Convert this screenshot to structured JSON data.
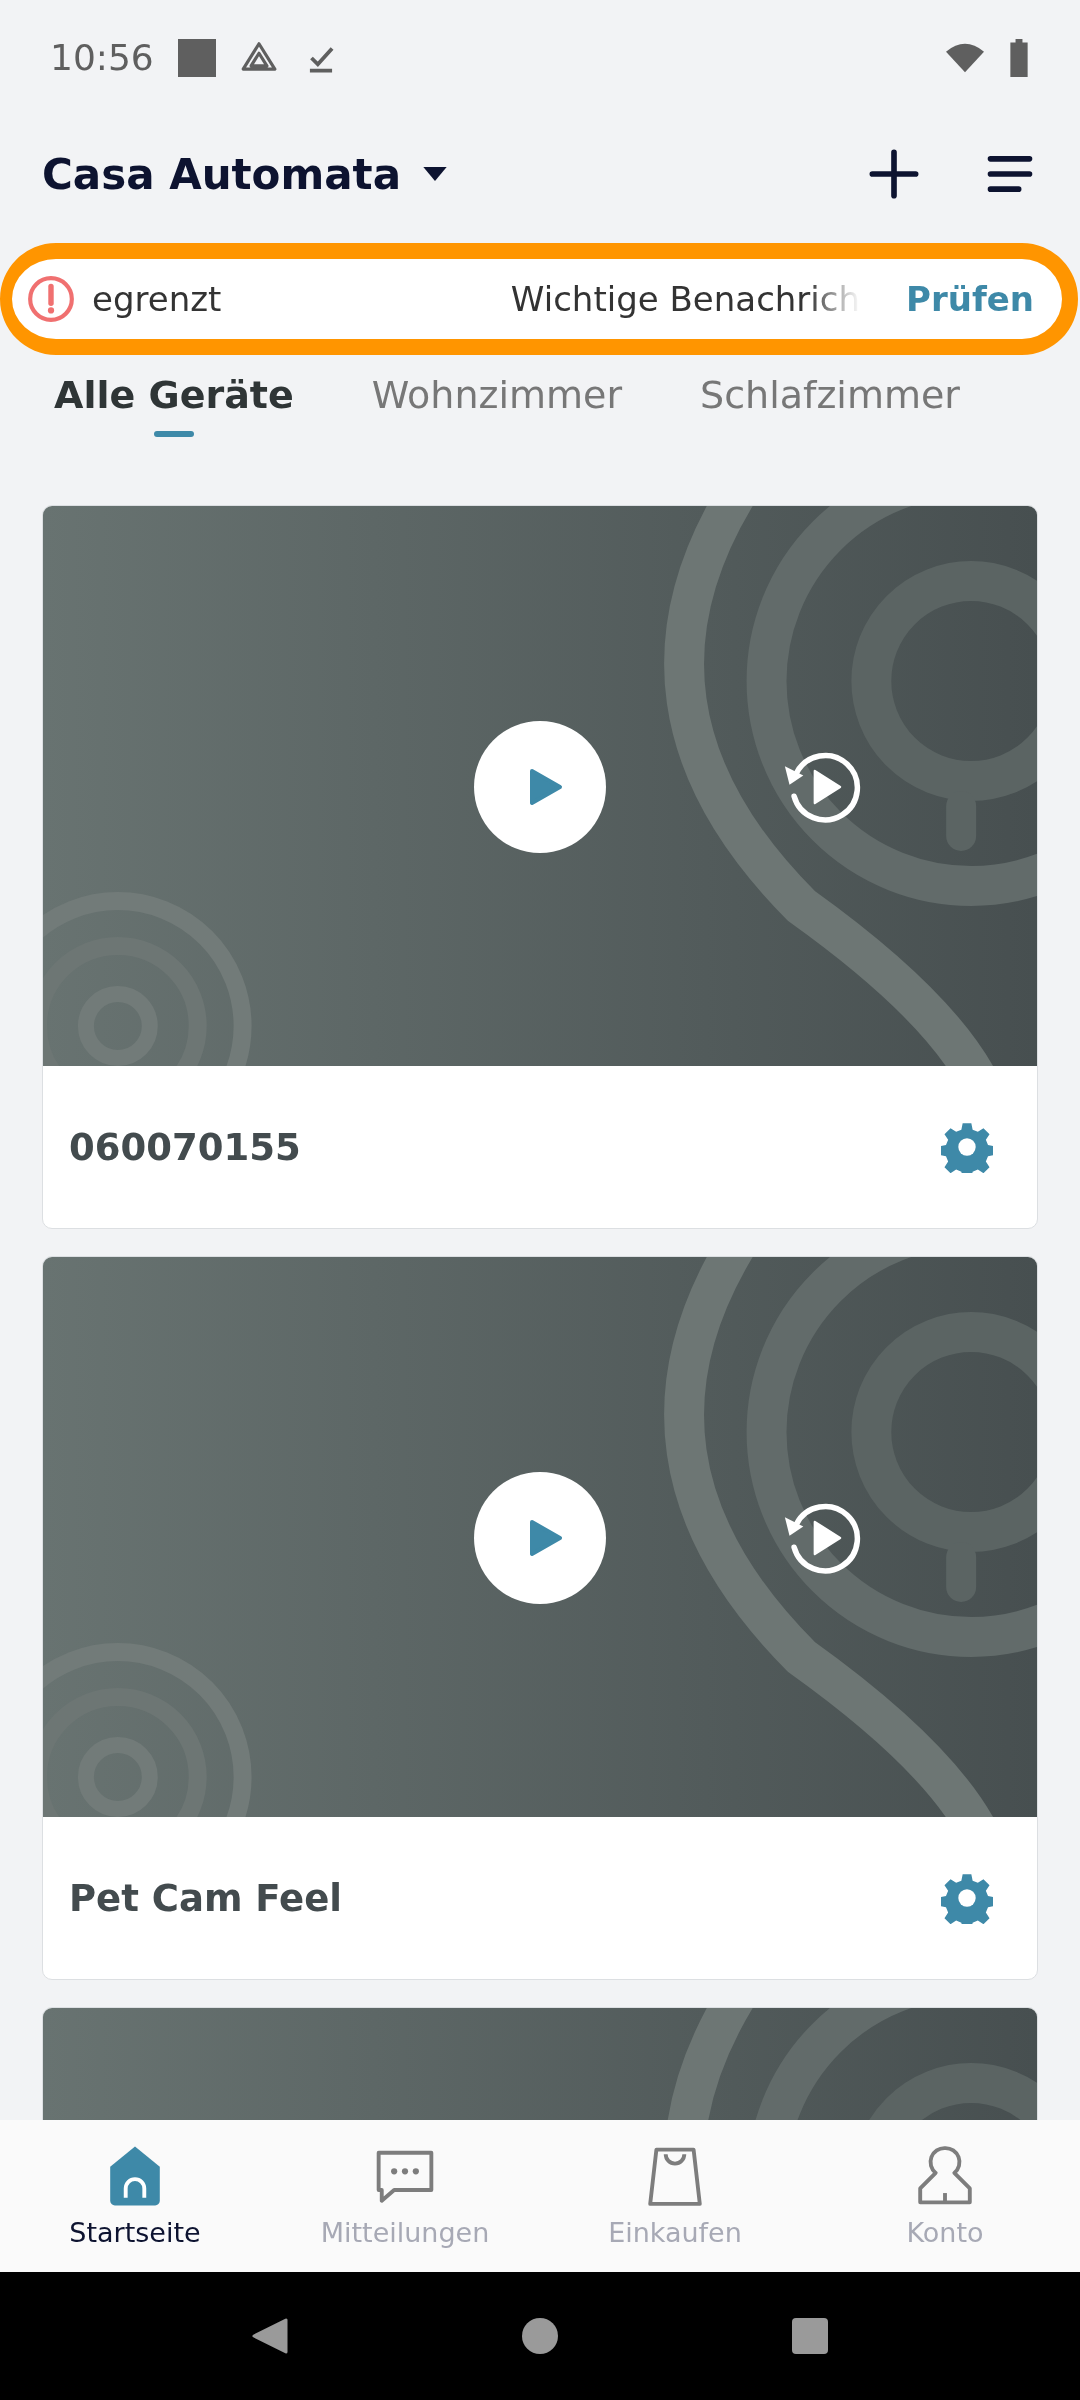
{
  "status_bar": {
    "time": "10:56"
  },
  "header": {
    "title": "Casa Automata"
  },
  "banner": {
    "text_scrolled": "egrenzt",
    "text": "Wichtige Benachrich",
    "action": "Prüfen"
  },
  "tabs": [
    {
      "label": "Alle Geräte",
      "selected": true
    },
    {
      "label": "Wohnzimmer",
      "selected": false
    },
    {
      "label": "Schlafzimmer",
      "selected": false
    }
  ],
  "cards": [
    {
      "kind": "camera",
      "name": "060070155"
    },
    {
      "kind": "camera",
      "name": "Pet Cam Feel"
    },
    {
      "kind": "camera"
    }
  ],
  "bottom_nav": [
    {
      "label": "Startseite",
      "kind": "home",
      "selected": true
    },
    {
      "label": "Mitteilungen",
      "kind": "chat",
      "selected": false
    },
    {
      "label": "Einkaufen",
      "kind": "bag",
      "selected": false
    },
    {
      "label": "Konto",
      "kind": "person",
      "selected": false
    }
  ]
}
